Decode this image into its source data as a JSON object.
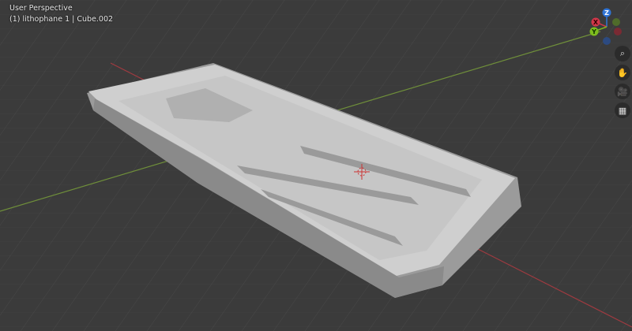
{
  "viewport": {
    "view_name": "User Perspective",
    "object_info": "(1) lithophane 1 | Cube.002"
  },
  "gizmo": {
    "axes": [
      {
        "label": "Z",
        "color": "#2f74d6"
      },
      {
        "label": "X",
        "color": "#d2374a"
      },
      {
        "label": "Y",
        "color": "#7ebd1e"
      }
    ]
  },
  "nav_buttons": [
    {
      "icon": "zoom-icon",
      "glyph": "⌕"
    },
    {
      "icon": "pan-hand-icon",
      "glyph": "✋"
    },
    {
      "icon": "camera-icon",
      "glyph": "🎥"
    },
    {
      "icon": "grid-perspective-icon",
      "glyph": "▦"
    }
  ]
}
